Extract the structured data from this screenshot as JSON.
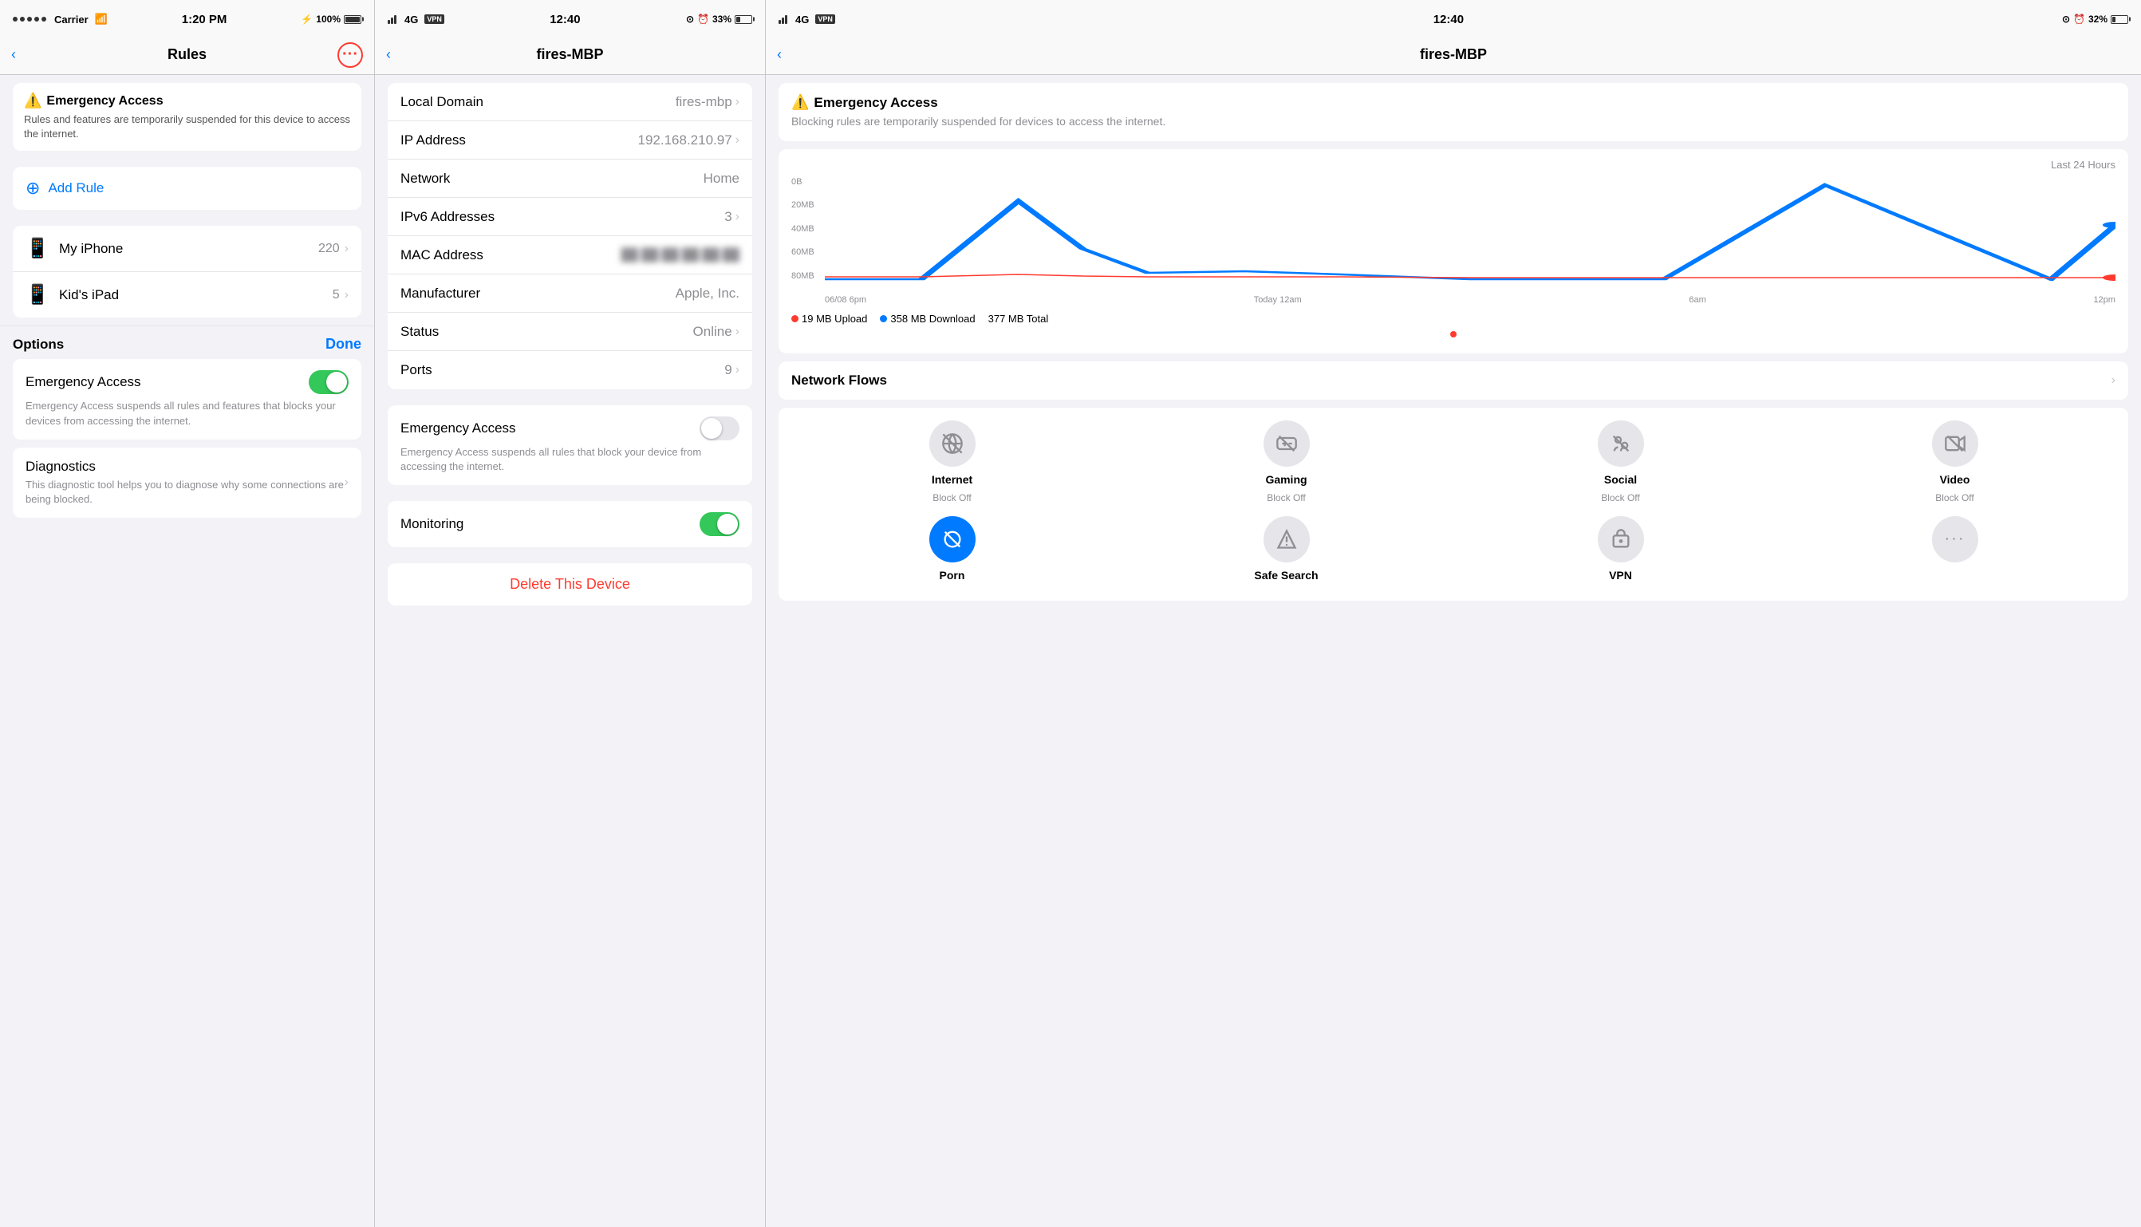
{
  "panel1": {
    "statusBar": {
      "carrier": "Carrier",
      "time": "1:20 PM",
      "battery": "100%"
    },
    "navTitle": "Rules",
    "emergency": {
      "title": "Emergency Access",
      "text": "Rules and features are temporarily suspended for this device to access the internet."
    },
    "addRule": "Add Rule",
    "devices": [
      {
        "name": "My iPhone",
        "count": "220",
        "icon": "📱"
      },
      {
        "name": "Kid's iPad",
        "count": "5",
        "icon": "📱"
      }
    ],
    "options": {
      "title": "Options",
      "doneLabel": "Done"
    },
    "emergencyAccess": {
      "label": "Emergency Access",
      "desc": "Emergency Access suspends all rules and features that blocks your devices from accessing the internet.",
      "on": true
    },
    "diagnostics": {
      "label": "Diagnostics",
      "desc": "This diagnostic tool helps you to diagnose why some connections are being blocked."
    }
  },
  "panel2": {
    "statusBar": {
      "signal": "4G",
      "vpn": "VPN",
      "time": "12:40",
      "battery": "33%"
    },
    "navTitle": "fires-MBP",
    "infoRows": [
      {
        "label": "Local Domain",
        "value": "fires-mbp",
        "hasChevron": true
      },
      {
        "label": "IP Address",
        "value": "192.168.210.97",
        "hasChevron": true
      },
      {
        "label": "Network",
        "value": "Home",
        "hasChevron": false
      },
      {
        "label": "IPv6 Addresses",
        "value": "3",
        "hasChevron": true
      },
      {
        "label": "MAC Address",
        "value": "blurred",
        "hasChevron": false
      },
      {
        "label": "Manufacturer",
        "value": "Apple, Inc.",
        "hasChevron": false
      },
      {
        "label": "Status",
        "value": "Online",
        "hasChevron": true
      },
      {
        "label": "Ports",
        "value": "9",
        "hasChevron": true
      }
    ],
    "emergencyAccess": {
      "label": "Emergency Access",
      "desc": "Emergency Access suspends all rules that block your device from accessing the internet.",
      "on": false
    },
    "monitoring": {
      "label": "Monitoring",
      "on": true
    },
    "deleteLabel": "Delete This Device"
  },
  "panel3": {
    "statusBar": {
      "signal": "4G",
      "vpn": "VPN",
      "time": "12:40",
      "battery": "32%"
    },
    "navTitle": "fires-MBP",
    "emergency": {
      "title": "Emergency Access",
      "text": "Blocking rules are temporarily suspended for devices to access the internet."
    },
    "chart": {
      "title": "Last 24 Hours",
      "yLabels": [
        "0B",
        "20MB",
        "40MB",
        "60MB",
        "80MB"
      ],
      "xLabels": [
        "06/08 6pm",
        "Today 12am",
        "6am",
        "12pm"
      ],
      "uploadColor": "#ff3b30",
      "downloadColor": "#007aff",
      "uploadLabel": "19 MB Upload",
      "downloadLabel": "358 MB Download",
      "totalLabel": "377 MB Total"
    },
    "networkFlows": "Network Flows",
    "blocks": [
      {
        "label": "Internet",
        "status": "Block Off",
        "icon": "📵",
        "active": false
      },
      {
        "label": "Gaming",
        "status": "Block Off",
        "icon": "🎮",
        "active": false
      },
      {
        "label": "Social",
        "status": "Block Off",
        "icon": "👥",
        "active": false
      },
      {
        "label": "Video",
        "status": "Block Off",
        "icon": "📹",
        "active": false
      },
      {
        "label": "Porn",
        "status": "",
        "icon": "🔞",
        "active": true
      },
      {
        "label": "Safe Search",
        "status": "",
        "icon": "🔍",
        "active": false
      },
      {
        "label": "VPN",
        "status": "",
        "icon": "🛡",
        "active": false
      },
      {
        "label": "More",
        "status": "",
        "icon": "•••",
        "active": false
      }
    ]
  }
}
